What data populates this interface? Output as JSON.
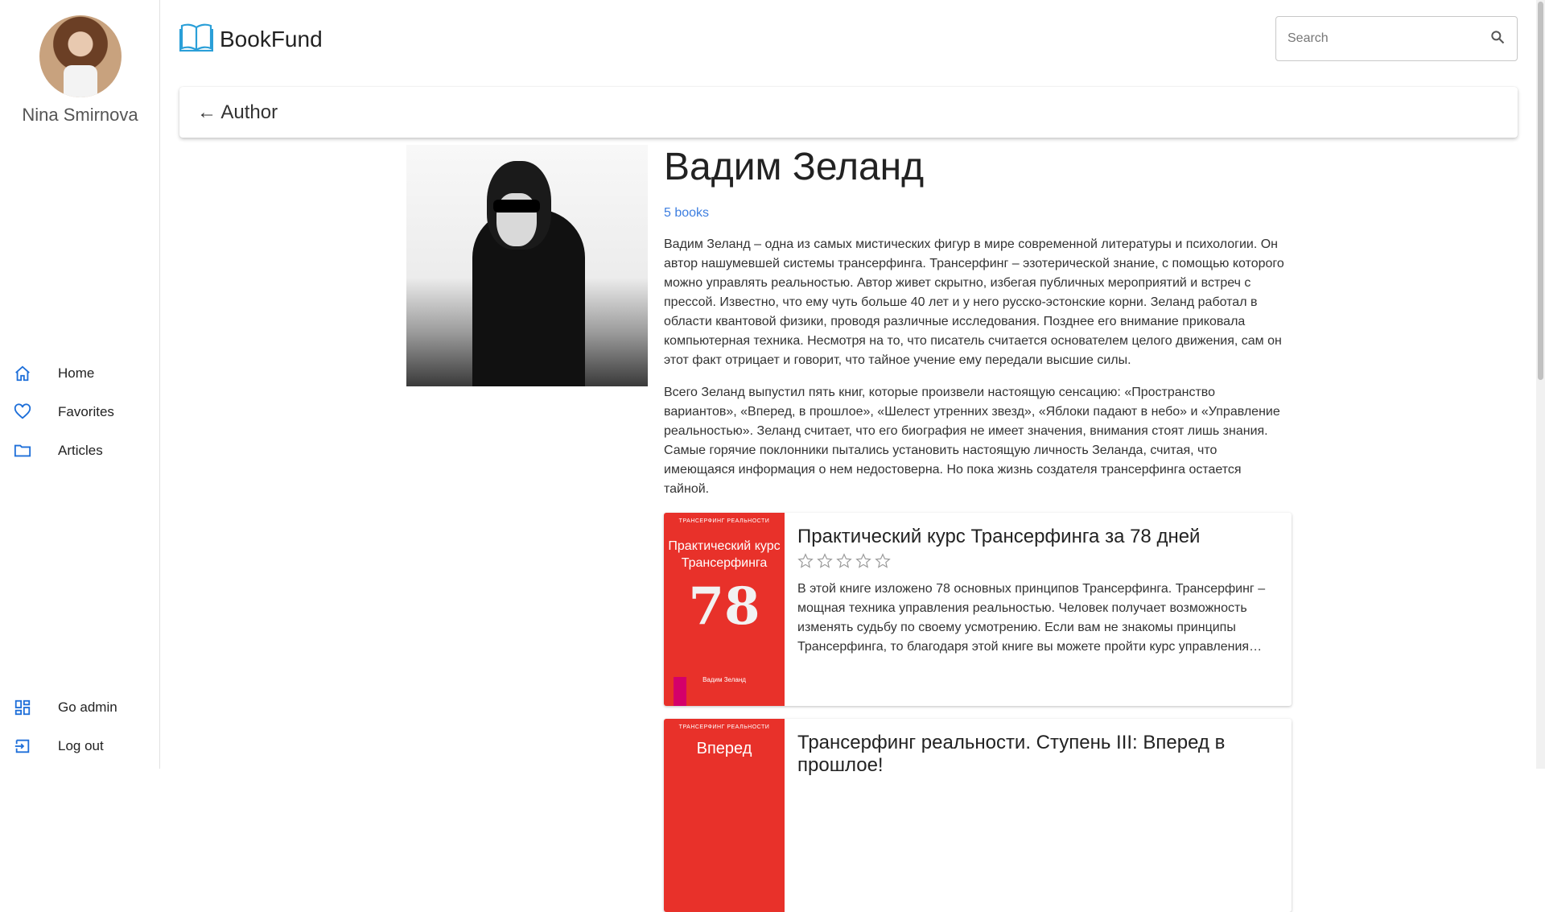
{
  "sidebar": {
    "user_name": "Nina Smirnova",
    "nav_main": [
      {
        "label": "Home",
        "icon": "home-icon"
      },
      {
        "label": "Favorites",
        "icon": "heart-icon"
      },
      {
        "label": "Articles",
        "icon": "folder-icon"
      }
    ],
    "nav_bottom": [
      {
        "label": "Go admin",
        "icon": "dashboard-icon"
      },
      {
        "label": "Log out",
        "icon": "logout-icon"
      }
    ]
  },
  "header": {
    "app_title": "BookFund",
    "search_placeholder": "Search"
  },
  "appbar": {
    "back_label": "← Author"
  },
  "author": {
    "name": "Вадим Зеланд",
    "books_count": "5 books",
    "bio_1": "Вадим Зеланд – одна из самых мистических фигур в мире современной литературы и психологии. Он автор нашумевшей системы трансерфинга. Трансерфинг – эзотерической знание, с помощью которого можно управлять реальностью. Автор живет скрытно, избегая публичных мероприятий и встреч с прессой. Известно, что ему чуть больше 40 лет и у него русско-эстонские корни. Зеланд работал в области квантовой физики, проводя различные исследования. Позднее его внимание приковала компьютерная техника. Несмотря на то, что писатель считается основателем целого движения, сам он этот факт отрицает и говорит, что тайное учение ему передали высшие силы.",
    "bio_2": "Всего Зеланд выпустил пять книг, которые произвели настоящую сенсацию: «Пространство вариантов», «Вперед, в прошлое», «Шелест утренних звезд», «Яблоки падают в небо» и «Управление реальностью». Зеланд считает, что его биография не имеет значения, внимания стоят лишь знания. Самые горячие поклонники пытались установить настоящую личность Зеланда, считая, что имеющаяся информация о нем недостоверна. Но пока жизнь создателя трансерфинга остается тайной."
  },
  "books": [
    {
      "title": "Практический курс Трансерфинга за 78 дней",
      "rating": 0,
      "description": "В этой книге изложено 78 основных принципов Трансерфинга. Трансерфинг – мощная техника управления реальностью. Человек получает возможность изменять судьбу по своему усмотрению. Если вам не знакомы принципы Трансерфинга, то благодаря этой книге вы можете пройти курс управления…",
      "cover": {
        "series": "ТРАНСЕРФИНГ РЕАЛЬНОСТИ",
        "title": "Практический курс Трансерфинга",
        "number": "78",
        "author": "Вадим Зеланд",
        "color": "#e8312a"
      }
    },
    {
      "title": "Трансерфинг реальности. Ступень III: Вперед в прошлое!",
      "rating": 0,
      "description": "",
      "cover": {
        "series": "ТРАНСЕРФИНГ РЕАЛЬНОСТИ",
        "title": "Вперед",
        "color": "#e8312a"
      }
    }
  ],
  "colors": {
    "accent": "#3d7ee0",
    "nav_icon": "#1e6fd9"
  }
}
